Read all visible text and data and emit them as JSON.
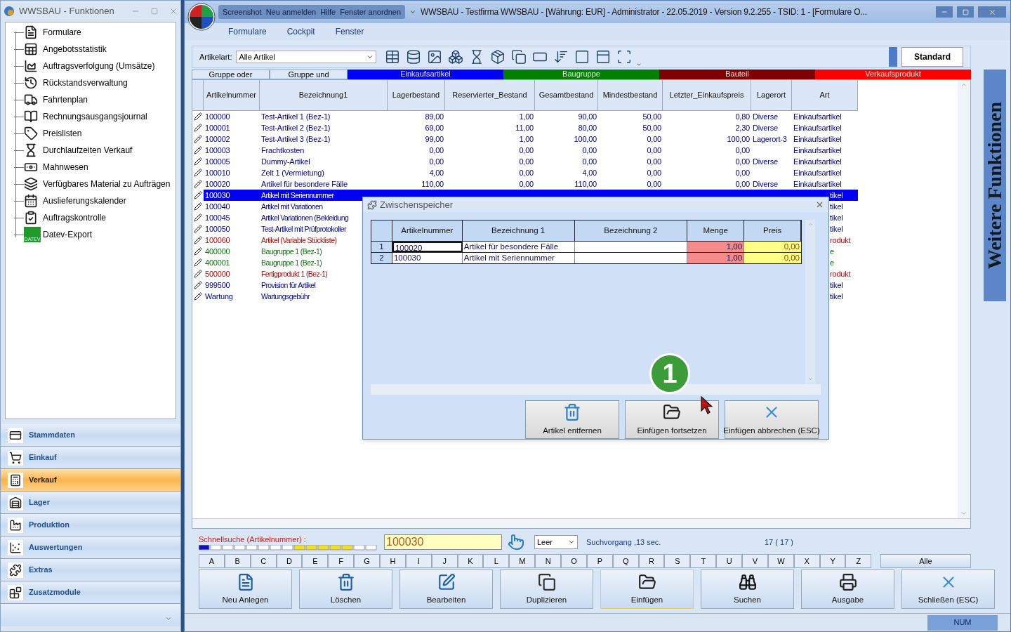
{
  "side_window": {
    "title": "WWSBAU - Funktionen",
    "tree": [
      {
        "label": "Formulare"
      },
      {
        "label": "Angebotsstatistik"
      },
      {
        "label": "Auftragsverfolgung (Umsätze)"
      },
      {
        "label": "Rückstandsverwaltung"
      },
      {
        "label": "Fahrtenplan"
      },
      {
        "label": "Rechnungsausgangsjournal"
      },
      {
        "label": "Preislisten"
      },
      {
        "label": "Durchlaufzeiten Verkauf"
      },
      {
        "label": "Mahnwesen"
      },
      {
        "label": "Verfügbares Material zu Aufträgen"
      },
      {
        "label": "Auslieferungskalender"
      },
      {
        "label": "Auftragskontrolle"
      },
      {
        "label": "Datev-Export",
        "icon_text": "DATEV"
      }
    ],
    "nav": [
      {
        "label": "Stammdaten",
        "selected": false
      },
      {
        "label": "Einkauf",
        "selected": false
      },
      {
        "label": "Verkauf",
        "selected": true
      },
      {
        "label": "Lager",
        "selected": false
      },
      {
        "label": "Produktion",
        "selected": false
      },
      {
        "label": "Auswertungen",
        "selected": false
      },
      {
        "label": "Extras",
        "selected": false
      },
      {
        "label": "Zusatzmodule",
        "selected": false
      }
    ]
  },
  "window": {
    "quick_menu": [
      "Screenshot",
      "Neu anmelden",
      "Hilfe",
      "Fenster anordnen"
    ],
    "title": "WWSBAU - Testfirma WWSBAU - [Währung: EUR] - Administrator - 22.05.2019 - Version 9.2.255 - TSID: 1 - [Formulare O...",
    "menu": [
      "Formulare",
      "Cockpit",
      "Fenster"
    ]
  },
  "toolbar": {
    "filter_label": "Artikelart:",
    "filter_value": "Alle Artikel",
    "standard_button": "Standard"
  },
  "side_tab": "Weitere Funktionen",
  "groups": [
    {
      "label": "Gruppe oder",
      "kind": "button"
    },
    {
      "label": "Gruppe und",
      "kind": "button"
    },
    {
      "label": "Einkaufsartikel",
      "kind": "color",
      "color": "#0000ff"
    },
    {
      "label": "Baugruppe",
      "kind": "color",
      "color": "#008000"
    },
    {
      "label": "Bauteil",
      "kind": "color",
      "color": "#800000"
    },
    {
      "label": "Verkaufsprodukt",
      "kind": "color",
      "color": "#ff0000"
    }
  ],
  "table": {
    "columns": [
      "Artikelnummer",
      "Bezeichnung1",
      "Lagerbestand",
      "Reservierter_Bestand",
      "Gesamtbestand",
      "Mindestbestand",
      "Letzter_Einkaufspreis",
      "Lagerort",
      "Art"
    ],
    "rows": [
      {
        "cells": [
          "100000",
          "Test-Artikel 1  (Bez-1)",
          "89,00",
          "1,00",
          "90,00",
          "50,00",
          "0,80",
          "Diverse",
          "Einkaufsartikel"
        ],
        "color": "#000080",
        "selected": false
      },
      {
        "cells": [
          "100001",
          "Test-Artikel 2  (Bez-1)",
          "69,00",
          "11,00",
          "80,00",
          "50,00",
          "2,30",
          "Diverse",
          "Einkaufsartikel"
        ],
        "color": "#000080",
        "selected": false
      },
      {
        "cells": [
          "100002",
          "Test-Artikel 3  (Bez-1)",
          "99,00",
          "1,00",
          "100,00",
          "0,00",
          "100,00",
          "Lagerort-3",
          "Einkaufsartikel"
        ],
        "color": "#000080",
        "selected": false
      },
      {
        "cells": [
          "100003",
          "Frachtkosten",
          "0,00",
          "0,00",
          "0,00",
          "0,00",
          "0,00",
          "",
          "Einkaufsartikel"
        ],
        "color": "#000080",
        "selected": false
      },
      {
        "cells": [
          "100005",
          "Dummy-Artikel",
          "0,00",
          "0,00",
          "0,00",
          "0,00",
          "0,00",
          "Diverse",
          "Einkaufsartikel"
        ],
        "color": "#000080",
        "selected": false
      },
      {
        "cells": [
          "100010",
          "Zelt 1 (Vermietung)",
          "4,00",
          "0,00",
          "4,00",
          "0,00",
          "0,00",
          "",
          "Einkaufsartikel"
        ],
        "color": "#000080",
        "selected": false
      },
      {
        "cells": [
          "100020",
          "Artikel für besondere Fälle",
          "110,00",
          "0,00",
          "110,00",
          "0,00",
          "0,00",
          "Diverse",
          "Einkaufsartikel"
        ],
        "color": "#000080",
        "selected": false
      },
      {
        "cells": [
          "100030",
          "Artikel mit Seriennummer",
          "tikel"
        ],
        "selected": true
      },
      {
        "cells": [
          "100040",
          "Artikel mit Variationen",
          "tikel"
        ],
        "color": "#000080",
        "selected": false
      },
      {
        "cells": [
          "100045",
          "Artikel Variationen (Bekleidung",
          "tikel"
        ],
        "color": "#000080",
        "selected": false
      },
      {
        "cells": [
          "100050",
          "Test-Artikel mit Prüfprotokoller",
          "tikel"
        ],
        "color": "#000080",
        "selected": false
      },
      {
        "cells": [
          "100060",
          "Artikel (Variable Stückliste)",
          "rodukt"
        ],
        "color": "#a01010",
        "selected": false
      },
      {
        "cells": [
          "400000",
          "Baugruppe 1  (Bez-1)",
          "e"
        ],
        "color": "#107010",
        "selected": false
      },
      {
        "cells": [
          "400001",
          "Baugruppe 1  (Bez-1)",
          "e"
        ],
        "color": "#107010",
        "selected": false
      },
      {
        "cells": [
          "500000",
          "Fertigprodukt 1  (Bez-1)",
          "rodukt"
        ],
        "color": "#a01010",
        "selected": false
      },
      {
        "cells": [
          "999500",
          "Provision für Artikel",
          "tikel"
        ],
        "color": "#000080",
        "selected": false
      },
      {
        "cells": [
          "Wartung",
          "Wartungsgebühr",
          "tikel"
        ],
        "color": "#000080",
        "selected": false
      }
    ]
  },
  "dialog": {
    "title": "Zwischenspeicher",
    "columns": [
      "Artikelnummer",
      "Bezeichnung 1",
      "Bezeichnung 2",
      "Menge",
      "Preis"
    ],
    "rows": [
      {
        "index": "1",
        "number": "100020",
        "name": "Artikel für besondere Fälle",
        "amount": "1,00",
        "price": "0,00",
        "selected": true
      },
      {
        "index": "2",
        "number": "100030",
        "name": "Artikel mit Seriennummer",
        "amount": "1,00",
        "price": "0,00",
        "selected": false
      }
    ],
    "buttons": [
      "Artikel entfernen",
      "Einfügen fortsetzen",
      "Einfügen abbrechen (ESC)"
    ],
    "callout": "1"
  },
  "quick_search": {
    "label": "Schnellsuche (Artikelnummer) :",
    "value": "100030",
    "mode": "Leer",
    "timing": "Suchvorgang ,13 sec.",
    "count": "17 ( 17 )"
  },
  "letters": [
    "A",
    "B",
    "C",
    "D",
    "E",
    "F",
    "G",
    "H",
    "I",
    "J",
    "K",
    "L",
    "M",
    "N",
    "O",
    "P",
    "Q",
    "R",
    "S",
    "T",
    "U",
    "V",
    "W",
    "X",
    "Y",
    "Z"
  ],
  "all_button": "Alle",
  "actions": [
    {
      "label": "Neu Anlegen",
      "selected": false
    },
    {
      "label": "Löschen",
      "selected": false
    },
    {
      "label": "Bearbeiten",
      "selected": false
    },
    {
      "label": "Duplizieren",
      "selected": false
    },
    {
      "label": "Einfügen",
      "selected": true
    },
    {
      "label": "Suchen",
      "selected": false
    },
    {
      "label": "Ausgabe",
      "selected": false
    },
    {
      "label": "Schließen (ESC)",
      "selected": false
    }
  ],
  "status": {
    "num": "NUM"
  }
}
